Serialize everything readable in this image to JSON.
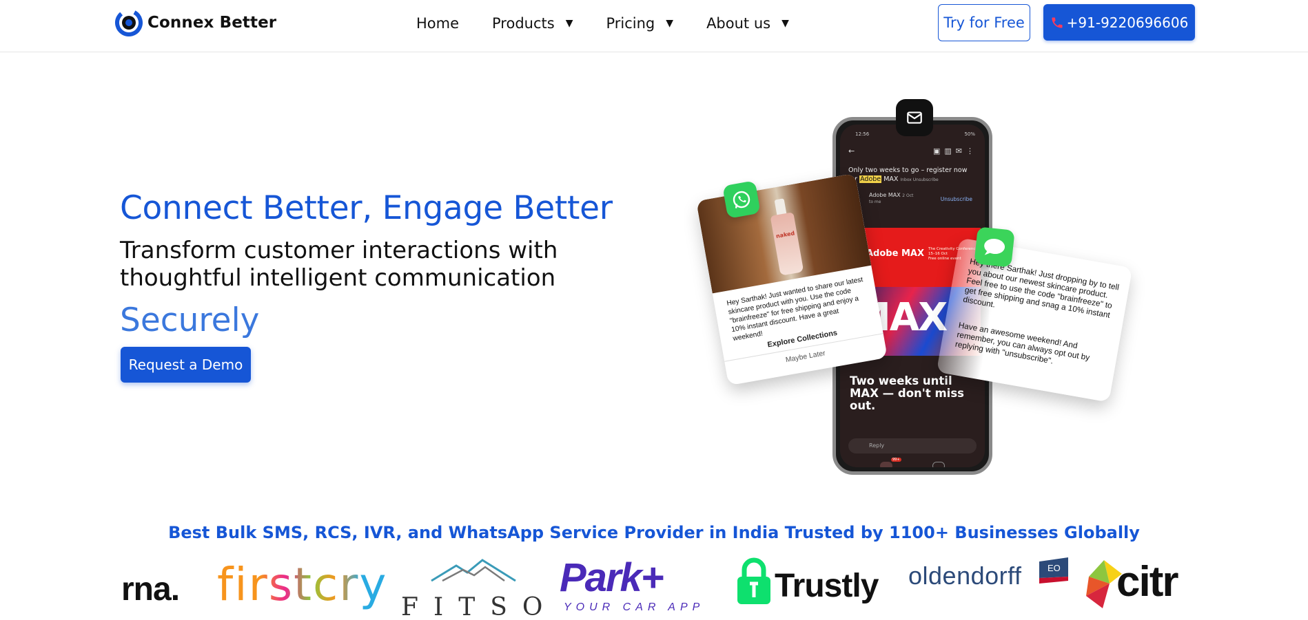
{
  "header": {
    "brand_name": "Connex Better",
    "nav": [
      {
        "label": "Home",
        "has_dropdown": false
      },
      {
        "label": "Products",
        "has_dropdown": true
      },
      {
        "label": "Pricing",
        "has_dropdown": true
      },
      {
        "label": "About us",
        "has_dropdown": true
      }
    ],
    "try_label": "Try for Free",
    "phone_label": "+91-9220696606"
  },
  "hero": {
    "title": "Connect Better, Engage Better",
    "subtitle_line1": "Transform customer interactions with",
    "subtitle_line2": "thoughtful intelligent communication",
    "rotating_word": "Securely",
    "demo_label": "Request a Demo"
  },
  "illustration": {
    "phone": {
      "status_time": "12:56",
      "status_battery": "50%",
      "subject_prefix": "Only two weeks to go – register now for",
      "subject_highlight": "Adobe",
      "subject_suffix": "MAX",
      "tags": "Inbox  Unsubscribe",
      "sender": "Adobe MAX",
      "sender_date": "2 Oct",
      "recipient": "to me",
      "unsubscribe": "Unsubscribe",
      "banner_title": "Adobe MAX",
      "banner_detail_1": "The Creativity Conference",
      "banner_detail_2": "15–16 Oct",
      "banner_detail_3": "Free online event",
      "art_text": "MAX",
      "body_text": "Two weeks until MAX — don't miss out.",
      "reply_label": "Reply",
      "badge_count": "99+"
    },
    "whatsapp_card": {
      "product_label": "naked",
      "message": "Hey Sarthak! Just wanted to share our latest skincare product with you. Use the code \"brainfreeze\" for free shipping and enjoy a 10% instant discount. Have a great weekend!",
      "primary_action": "Explore Collections",
      "secondary_action": "Maybe Later"
    },
    "sms_card": {
      "message_1": "Hey there Sarthak! Just dropping by to tell you about our newest skincare product. Feel free to use the code \"brainfreeze\" to get free shipping and snag a 10% instant discount.",
      "message_2": "Have an awesome weekend! And remember, you can always opt out by replying with \"unsubscribe\"."
    }
  },
  "trusted": {
    "headline": "Best Bulk SMS, RCS, IVR, and WhatsApp Service Provider in India Trusted by 1100+ Businesses Globally",
    "logos": {
      "rna": "rna.",
      "firstcry": "firstcry",
      "fitso": "FITSO",
      "park": "Park+",
      "park_tagline": "YOUR CAR APP",
      "trustly": "Trustly",
      "oldendorff": "oldendorff",
      "oldendorff_mark": "EO",
      "citr": "citr"
    }
  },
  "colors": {
    "brand_blue": "#1656d6",
    "rotator_blue": "#3b78dd",
    "whatsapp_green": "#2fd05d",
    "messages_green": "#3bd45a",
    "trustly_green": "#0ee06e",
    "park_purple": "#4a2ab8"
  },
  "icons": {
    "brand": "connex-logo-icon",
    "caret": "caret-down-icon",
    "phone": "phone-icon",
    "mail": "mail-icon",
    "whatsapp": "whatsapp-icon",
    "messages": "messages-icon"
  }
}
